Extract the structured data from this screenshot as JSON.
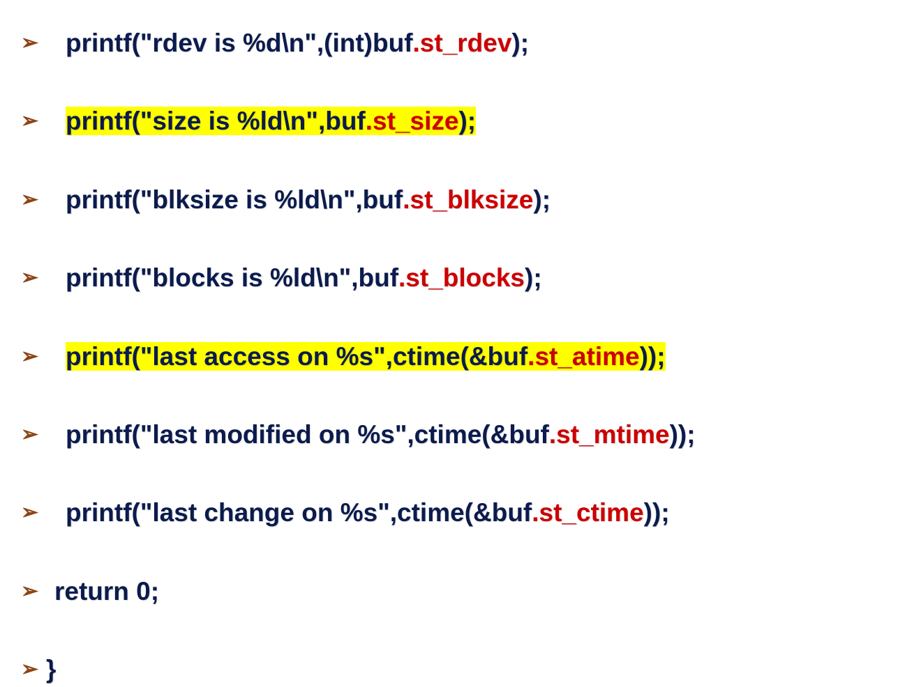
{
  "lines": [
    {
      "highlighted": false,
      "indent": true,
      "parts": [
        {
          "text": "printf(\"rdev is %d\\n\",(int)buf",
          "cls": "navy"
        },
        {
          "text": ".st_rdev",
          "cls": "red"
        },
        {
          "text": ");",
          "cls": "navy"
        }
      ]
    },
    {
      "highlighted": true,
      "indent": true,
      "parts": [
        {
          "text": "printf(\"size is %ld\\n\",buf",
          "cls": "navy"
        },
        {
          "text": ".st_size",
          "cls": "red"
        },
        {
          "text": ");",
          "cls": "navy"
        }
      ]
    },
    {
      "highlighted": false,
      "indent": true,
      "parts": [
        {
          "text": "printf(\"blksize is %ld\\n\",buf",
          "cls": "navy"
        },
        {
          "text": ".st_blksize",
          "cls": "red"
        },
        {
          "text": ");",
          "cls": "navy"
        }
      ]
    },
    {
      "highlighted": false,
      "indent": true,
      "parts": [
        {
          "text": "printf(\"blocks is %ld\\n\",buf",
          "cls": "navy"
        },
        {
          "text": ".st_blocks",
          "cls": "red"
        },
        {
          "text": ");",
          "cls": "navy"
        }
      ]
    },
    {
      "highlighted": true,
      "indent": true,
      "parts": [
        {
          "text": "printf(\"last access on  %s\",ctime(&buf",
          "cls": "navy"
        },
        {
          "text": ".st_atime",
          "cls": "red"
        },
        {
          "text": "));",
          "cls": "navy"
        }
      ]
    },
    {
      "highlighted": false,
      "indent": true,
      "parts": [
        {
          "text": "printf(\"last modified on %s\",ctime(&buf",
          "cls": "navy"
        },
        {
          "text": ".st_mtime",
          "cls": "red"
        },
        {
          "text": "));",
          "cls": "navy"
        }
      ]
    },
    {
      "highlighted": false,
      "indent": true,
      "parts": [
        {
          "text": "printf(\"last change on %s\",ctime(&buf",
          "cls": "navy"
        },
        {
          "text": ".st_ctime",
          "cls": "red"
        },
        {
          "text": "));",
          "cls": "navy"
        }
      ]
    },
    {
      "highlighted": false,
      "indent": false,
      "parts": [
        {
          "text": "return 0;",
          "cls": "navy"
        }
      ]
    },
    {
      "highlighted": false,
      "indent": false,
      "tight": true,
      "parts": [
        {
          "text": "}",
          "cls": "navy"
        }
      ]
    }
  ]
}
